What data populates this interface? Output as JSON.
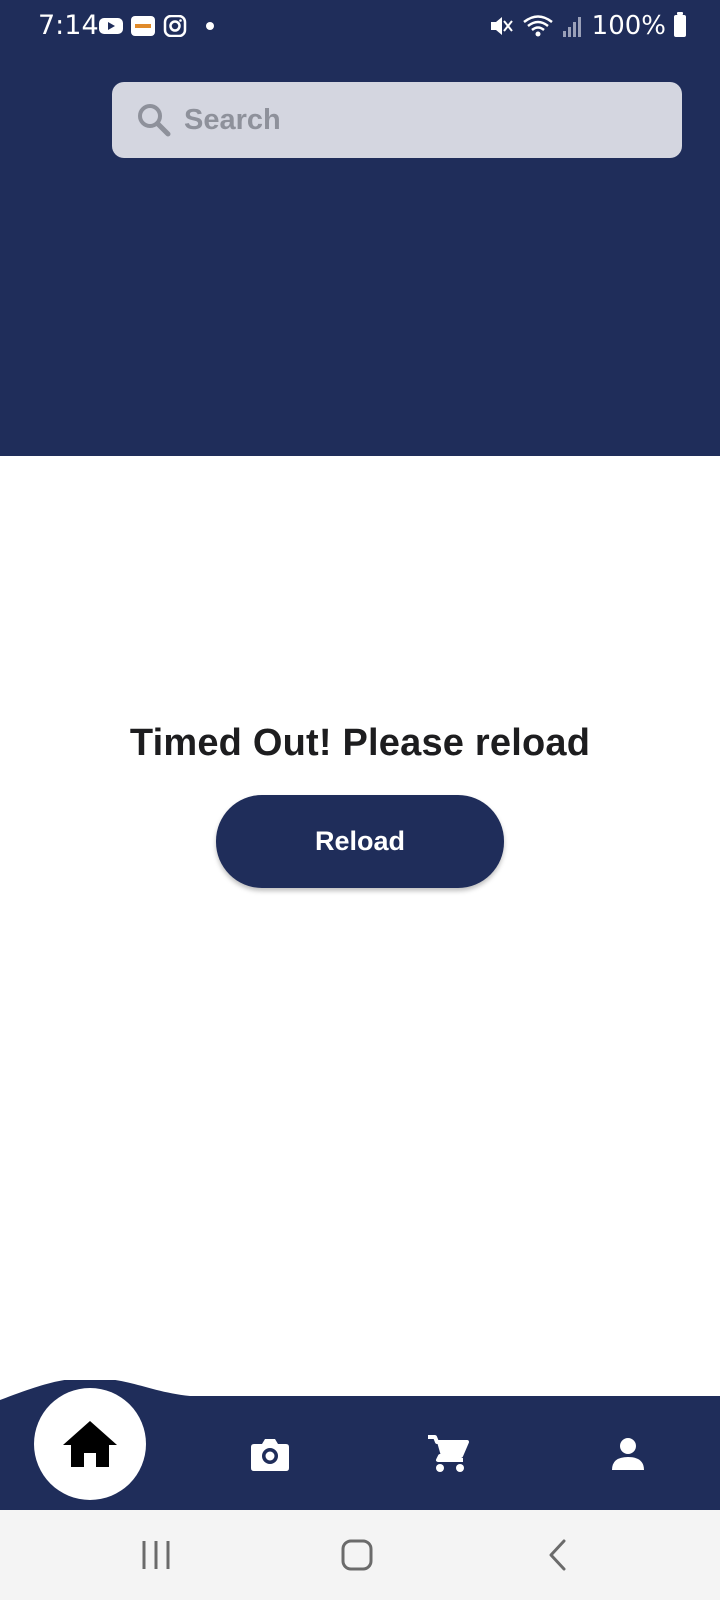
{
  "status_bar": {
    "time": "7:14",
    "battery": "100%"
  },
  "search": {
    "placeholder": "Search"
  },
  "main": {
    "message": "Timed Out! Please reload",
    "reload_label": "Reload"
  },
  "bottom_nav": {
    "items": [
      "home-icon",
      "camera-icon",
      "cart-icon",
      "profile-icon"
    ],
    "active": "home-icon"
  },
  "colors": {
    "primary": "#1f2d5a",
    "search_bg": "#d4d6e0",
    "system_nav_bg": "#f4f4f4"
  }
}
